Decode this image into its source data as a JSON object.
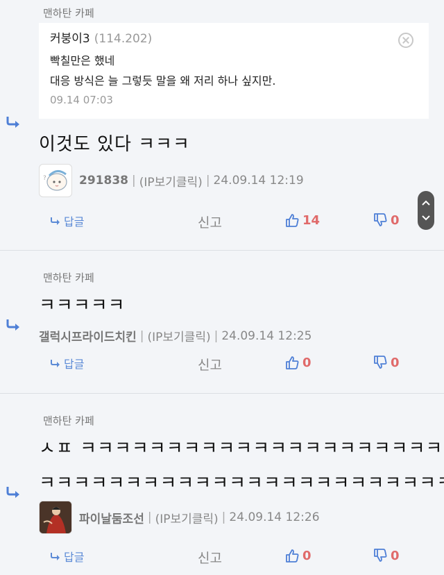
{
  "comments": [
    {
      "cafe_label": "맨하탄 카페",
      "quote": {
        "author": "커붕이3",
        "ip": "(114.202)",
        "lines": [
          "빡칠만은 했네",
          "대응 방식은 늘 그렇듯 말을 왜 저리 하나 싶지만."
        ],
        "time": "09.14 07:03"
      },
      "text": "이것도 있다 ㅋㅋㅋ",
      "nickname": "291838",
      "ip_label": "(IP보기클릭)",
      "datetime": "24.09.14 12:19",
      "reply_label": "답글",
      "report_label": "신고",
      "likes": "14",
      "dislikes": "0"
    },
    {
      "cafe_label": "맨하탄 카페",
      "text": "ㅋㅋㅋㅋㅋ",
      "nickname": "갤럭시프라이드치킨",
      "ip_label": "(IP보기클릭)",
      "datetime": "24.09.14 12:25",
      "reply_label": "답글",
      "report_label": "신고",
      "likes": "0",
      "dislikes": "0"
    },
    {
      "cafe_label": "맨하탄 카페",
      "text_line1": "ㅅㅍ ㅋㅋㅋㅋㅋㅋㅋㅋㅋㅋㅋㅋㅋㅋㅋㅋㅋㅋㅋㅋㅋㅋㅋ",
      "text_line2": "ㅋㅋㅋㅋㅋㅋㅋㅋㅋㅋㅋㅋㅋㅋㅋㅋㅋㅋㅋㅋㅋㅋㅋㅋ",
      "nickname": "파이날둠조선",
      "ip_label": "(IP보기클릭)",
      "datetime": "24.09.14 12:26",
      "reply_label": "답글",
      "report_label": "신고",
      "likes": "0",
      "dislikes": "0"
    }
  ],
  "colors": {
    "accent_blue": "#4e7fd6",
    "accent_red": "#e06a6a",
    "background": "#f3f5f8"
  }
}
